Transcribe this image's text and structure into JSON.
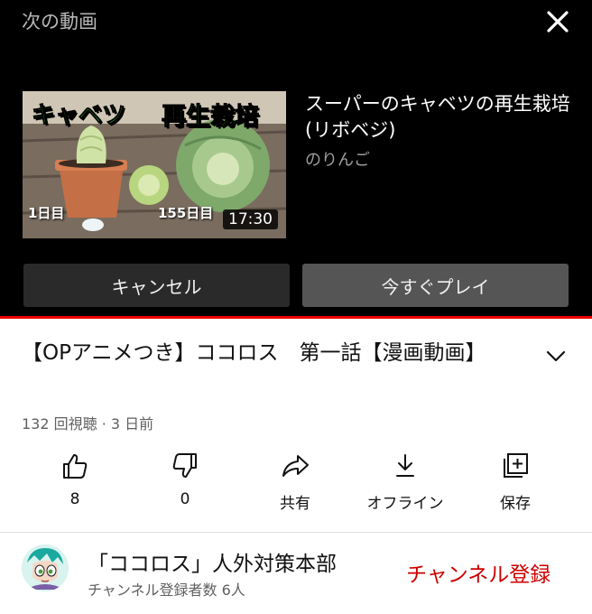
{
  "up_next": {
    "header": "次の動画",
    "video_title": "スーパーのキャベツの再生栽培(リボベジ)",
    "channel": "のりんご",
    "duration": "17:30",
    "thumbnail_text": {
      "headline_left": "キャベツ",
      "headline_right": "再生栽培",
      "day_left": "1日目",
      "day_right": "155日目"
    },
    "cancel_label": "キャンセル",
    "play_now_label": "今すぐプレイ"
  },
  "video": {
    "title": "【OPアニメつき】ココロス　第一話【漫画動画】",
    "meta": "132 回視聴 · 3 日前"
  },
  "actions": {
    "like_count": "8",
    "dislike_count": "0",
    "share_label": "共有",
    "offline_label": "オフライン",
    "save_label": "保存"
  },
  "channel": {
    "name": "「ココロス」人外対策本部",
    "subscribers": "チャンネル登録者数 6人",
    "subscribe_label": "チャンネル登録"
  },
  "colors": {
    "accent_red": "#cc0000",
    "progress_red": "#ee0000",
    "panel_bg": "#000000"
  }
}
